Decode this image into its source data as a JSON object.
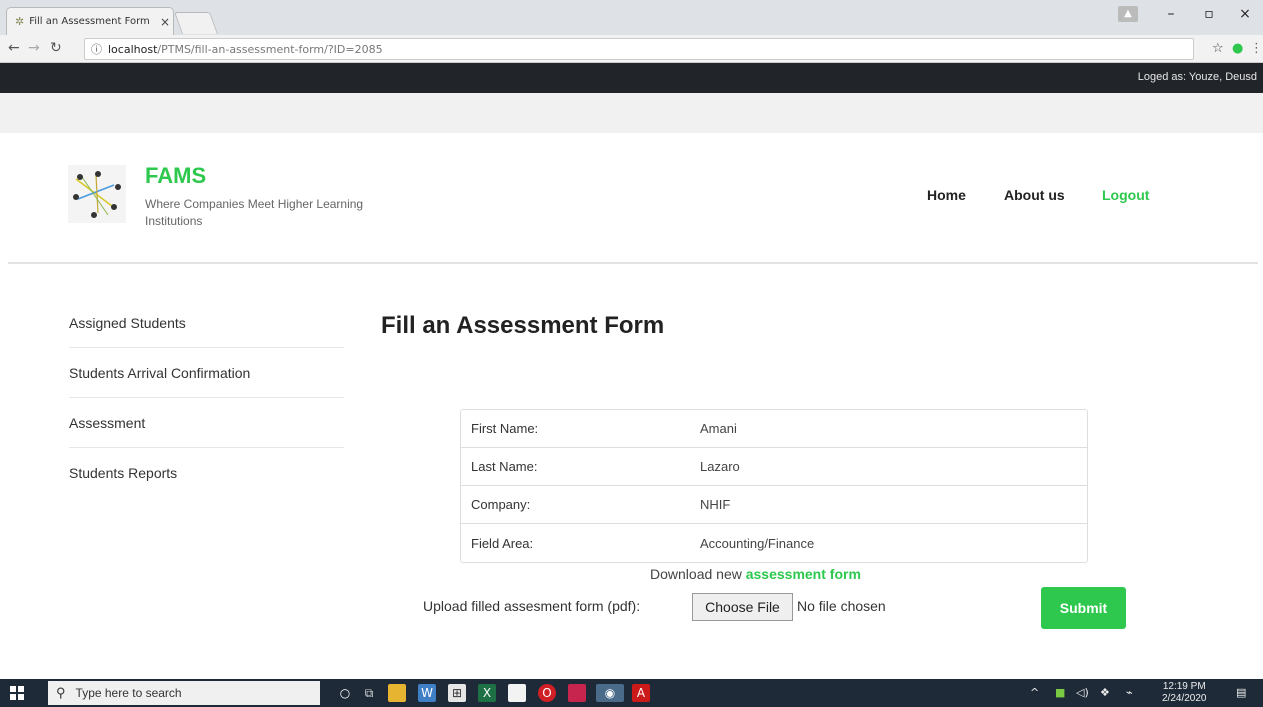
{
  "browser": {
    "tab_title": "Fill an Assessment Form",
    "tab_close": "×",
    "url_host": "localhost",
    "url_path": "/PTMS/fill-an-assessment-form/?ID=2085"
  },
  "site": {
    "logged_as": "Loged as: Youze, Deusd",
    "brand": "FAMS",
    "tagline": "Where Companies Meet Higher Learning Institutions",
    "accent_color": "#2dc84d",
    "nav": {
      "home": "Home",
      "about": "About us",
      "logout": "Logout"
    }
  },
  "sidebar": {
    "items": [
      {
        "label": "Assigned Students"
      },
      {
        "label": "Students Arrival Confirmation"
      },
      {
        "label": "Assessment"
      },
      {
        "label": "Students Reports"
      }
    ]
  },
  "main": {
    "heading": "Fill an Assessment Form",
    "fields": [
      {
        "label": "First Name:",
        "value": "Amani"
      },
      {
        "label": "Last Name:",
        "value": "Lazaro"
      },
      {
        "label": "Company:",
        "value": "NHIF"
      },
      {
        "label": "Field Area:",
        "value": "Accounting/Finance"
      }
    ],
    "download_prefix": "Download new",
    "download_link": "assessment form",
    "upload_label": "Upload filled assesment form (pdf):",
    "choose_file": "Choose File",
    "no_file": "No file chosen",
    "submit": "Submit"
  },
  "taskbar": {
    "search_placeholder": "Type here to search",
    "time": "12:19 PM",
    "date": "2/24/2020"
  }
}
